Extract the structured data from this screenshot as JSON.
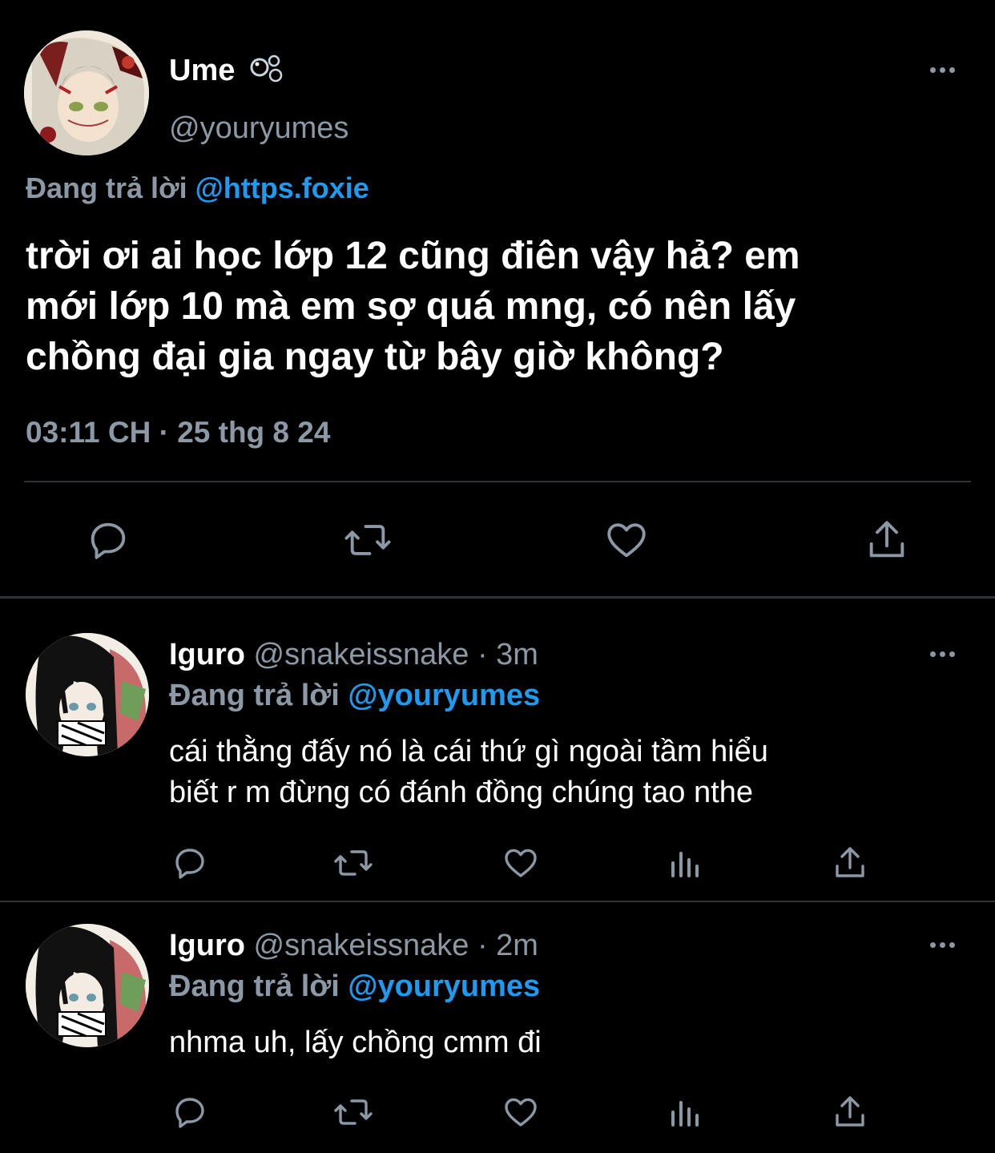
{
  "main_tweet": {
    "display_name": "Ume",
    "handle": "@youryumes",
    "replying_prefix": "Đang trả lời",
    "replying_to": "@https.foxie",
    "text_lines": [
      "trời ơi ai học lớp 12 cũng điên vậy hả? em",
      "mới lớp 10 mà em sợ quá mng, có nên lấy",
      "chồng đại gia ngay từ bây giờ không?"
    ],
    "timestamp": "03:11 CH · 25 thg 8 24"
  },
  "replies": [
    {
      "display_name": "Iguro",
      "handle": "@snakeissnake",
      "separator": "·",
      "time": "3m",
      "replying_prefix": "Đang trả lời",
      "replying_to": "@youryumes",
      "text_lines": [
        "cái thằng đấy nó là cái thứ gì ngoài tầm hiểu",
        "biết r m đừng có đánh đồng chúng tao nthe"
      ]
    },
    {
      "display_name": "Iguro",
      "handle": "@snakeissnake",
      "separator": "·",
      "time": "2m",
      "replying_prefix": "Đang trả lời",
      "replying_to": "@youryumes",
      "text_lines": [
        "nhma uh, lấy chồng cmm đi"
      ]
    }
  ],
  "icons": {
    "verified_badge": "bubbles-emoji-icon",
    "reply": "reply-icon",
    "retweet": "retweet-icon",
    "like": "heart-icon",
    "analytics": "analytics-icon",
    "share": "share-icon",
    "more": "more-icon"
  },
  "colors": {
    "background": "#000000",
    "text": "#ffffff",
    "secondary": "#8b98a5",
    "accent": "#1d9bf0",
    "divider": "#2f3336"
  }
}
